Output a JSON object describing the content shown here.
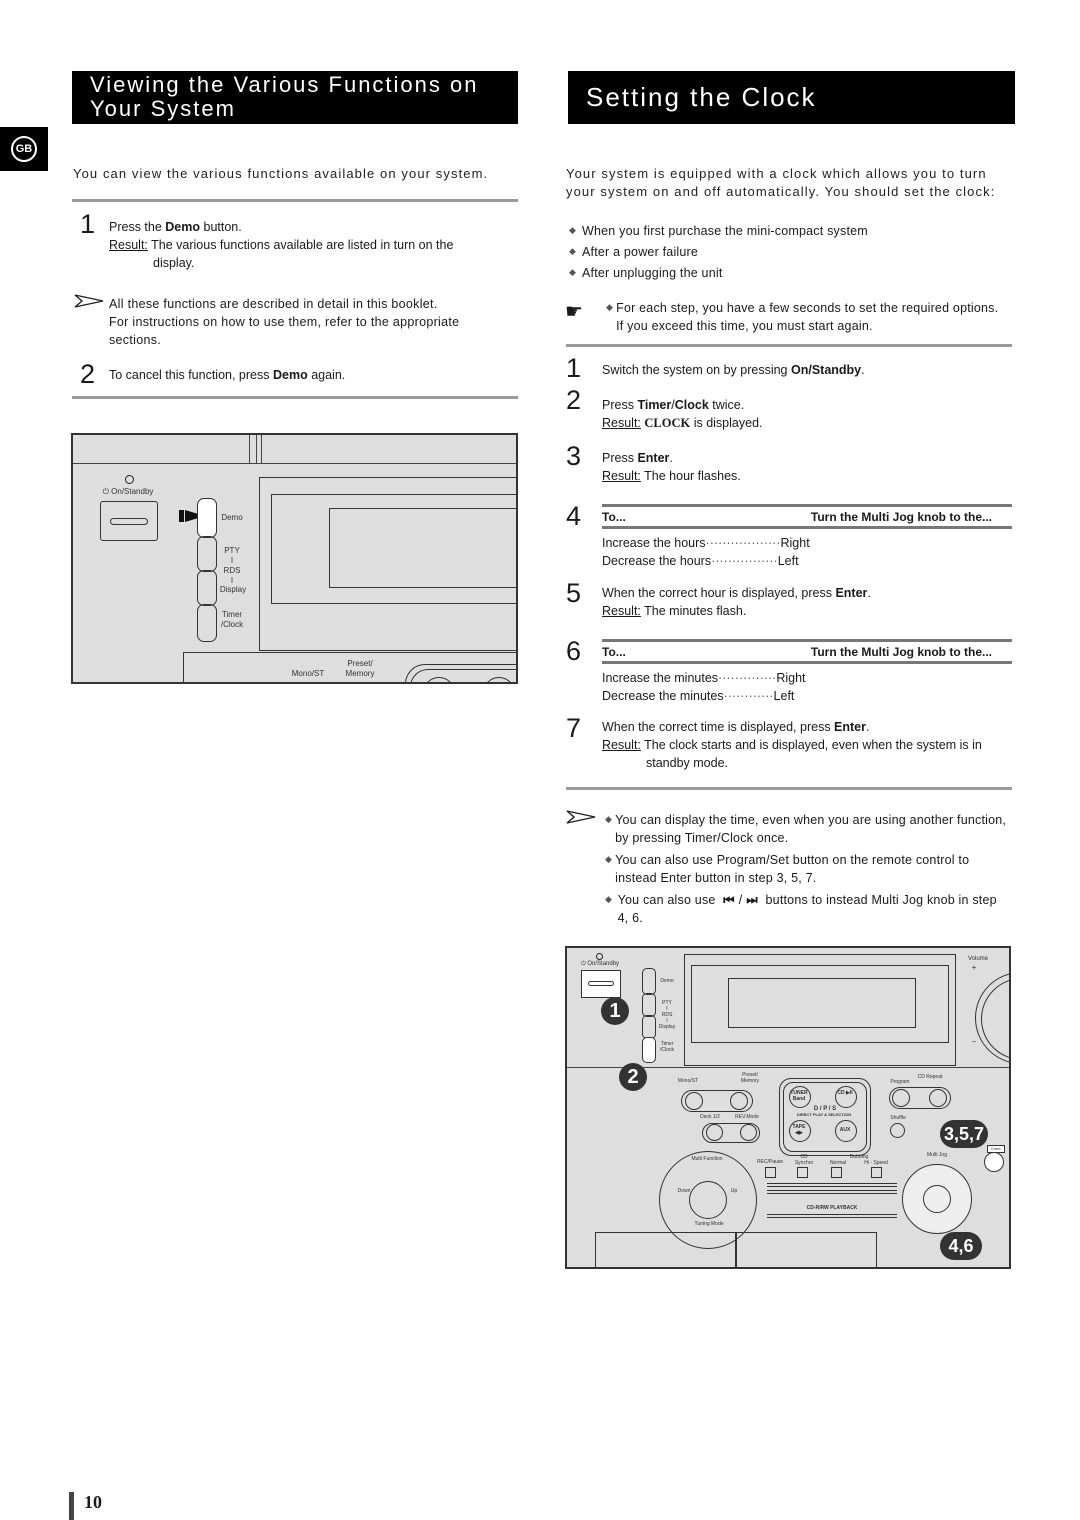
{
  "language_tab": "GB",
  "left": {
    "title": "Viewing the Various Functions on Your System",
    "intro": "You can view the various functions available on your system.",
    "steps": [
      {
        "num": "1",
        "pre": "Press the ",
        "bold": "Demo",
        "post": " button.",
        "result_label": "Result:",
        "result_text": "The various functions available are listed in turn on the",
        "result_cont": "display."
      },
      {
        "num": "2",
        "pre": "To cancel this function, press ",
        "bold": "Demo",
        "post": " again."
      }
    ],
    "note": [
      "All these functions are described in detail in this booklet.",
      "For instructions on how to use them, refer to the appropriate",
      "sections."
    ],
    "illustration": {
      "on_standby": "On/Standby",
      "buttons": [
        "Demo",
        "PTY",
        "I",
        "RDS",
        "I",
        "Display",
        "Timer",
        "/Clock"
      ],
      "mono_st": "Mono/ST",
      "preset": "Preset/",
      "memory": "Memory"
    }
  },
  "right": {
    "title": "Setting the Clock",
    "intro": "Your system is equipped with a clock which allows you to turn your system on and off automatically. You should set the clock:",
    "bullets": [
      "When you first purchase the mini-compact system",
      "After a power failure",
      "After unplugging the unit"
    ],
    "tip": "For each step, you have a few seconds to set the required options. If you exceed this time, you must start again.",
    "steps": {
      "s1": {
        "num": "1",
        "pre": "Switch the system on by pressing ",
        "bold": "On/Standby",
        "post": "."
      },
      "s2": {
        "num": "2",
        "pre": "Press ",
        "bold": "Timer",
        "mid": "/",
        "bold2": "Clock",
        "post": " twice.",
        "result_label": "Result:",
        "result_serif": "CLOCK",
        "result_text": " is displayed."
      },
      "s3": {
        "num": "3",
        "pre": "Press ",
        "bold": "Enter",
        "post": ".",
        "result_label": "Result:",
        "result_text": "The hour flashes."
      },
      "s4": {
        "num": "4",
        "col1": "To...",
        "col2": "Turn the Multi Jog knob to the...",
        "rows": [
          {
            "label": "Increase the hours",
            "dots": "··················",
            "value": "Right"
          },
          {
            "label": "Decrease the hours",
            "dots": "················",
            "value": "Left"
          }
        ]
      },
      "s5": {
        "num": "5",
        "pre": "When the correct hour is displayed, press ",
        "bold": "Enter",
        "post": ".",
        "result_label": "Result:",
        "result_text": "The minutes flash."
      },
      "s6": {
        "num": "6",
        "col1": "To...",
        "col2": "Turn the Multi Jog knob to the...",
        "rows": [
          {
            "label": "Increase the minutes",
            "dots": "··············",
            "value": "Right"
          },
          {
            "label": "Decrease the minutes",
            "dots": "············",
            "value": "Left"
          }
        ]
      },
      "s7": {
        "num": "7",
        "pre": "When the correct time is displayed, press ",
        "bold": "Enter",
        "post": ".",
        "result_label": "Result:",
        "result_text": "The clock starts and is displayed, even when the system is in",
        "result_cont": "standby mode."
      }
    },
    "notes": [
      "You can display the time, even when you are using another function, by pressing Timer/Clock once.",
      "You can also use Program/Set button on the remote control to instead Enter button in step 3, 5, 7."
    ],
    "note3_pre": "You can also use",
    "note3_sep": "/",
    "note3_post": "buttons to instead Multi Jog knob in step 4, 6.",
    "illustration": {
      "on_standby": "On/Standby",
      "buttons": [
        "Demo",
        "PTY",
        "I",
        "RDS",
        "I",
        "Display",
        "Timer",
        "/Clock"
      ],
      "volume": "Volume",
      "plus": "+",
      "minus": "−",
      "mono_st": "Mono/ST",
      "preset_memory": "Preset/ Memory",
      "deck": "Deck 1/2",
      "rev_mode": "REV.Mode",
      "tuner_band": "TUNER Band",
      "cd_play": "CD ▶II",
      "dps": "D / P / S",
      "dps_sub": "DIRECT PLAY & SELECTION",
      "tape": "TAPE ◀▶",
      "aux": "AUX",
      "program": "Program",
      "cd_repeat": "CD Repeat",
      "shuffle": "Shuffle",
      "enter": "Enter",
      "rec_pause": "REC/Pause",
      "cd_synchro": "CD Synchro",
      "dubbing": "Dubbing",
      "normal": "Normal",
      "hi_speed": "Hi - Speed",
      "multi_function": "Multi Function",
      "down": "Down",
      "up": "Up",
      "tuning_mode": "Tuning Mode",
      "cdrw": "CD-R/RW PLAYBACK",
      "multi_jog": "Multi Jog",
      "badges": [
        "1",
        "2",
        "3,5,7",
        "4,6"
      ]
    }
  },
  "page_number": "10"
}
